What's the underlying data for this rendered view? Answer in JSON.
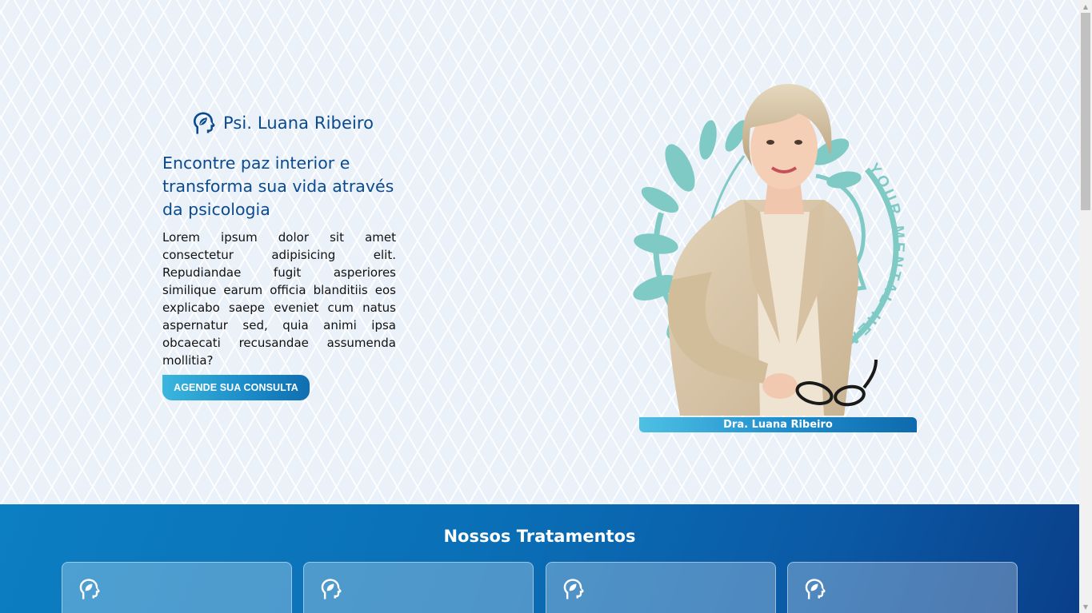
{
  "hero": {
    "brand_name": "Psi. Luana Ribeiro",
    "headline": "Encontre paz interior e transforma sua vida através da psicologia",
    "lead": "Lorem ipsum dolor sit amet consectetur adipisicing elit. Repudiandae fugit asperiores similique earum officia blanditiis eos explicabo saepe eveniet cum natus aspernatur sed, quia animi ipsa obcaecati recusandae assumenda mollitia?",
    "cta_label": "AGENDE SUA CONSULTA",
    "photo_caption": "Dra. Luana Ribeiro",
    "emblem_text": "YOUR MENTAL HEALTH",
    "brand_icon": "head-leaf-icon"
  },
  "treatments": {
    "title": "Nossos Tratamentos",
    "card_icon": "head-leaf-icon",
    "cards": [
      {
        "title": ""
      },
      {
        "title": ""
      },
      {
        "title": ""
      },
      {
        "title": ""
      }
    ]
  },
  "colors": {
    "brand_blue": "#0b4a8f",
    "cta_start": "#3bb6de",
    "cta_end": "#0f6eb0",
    "emblem_teal": "#7fcac4",
    "section_blue": "#0c7ec2",
    "hero_bg": "#eaf1f8"
  }
}
